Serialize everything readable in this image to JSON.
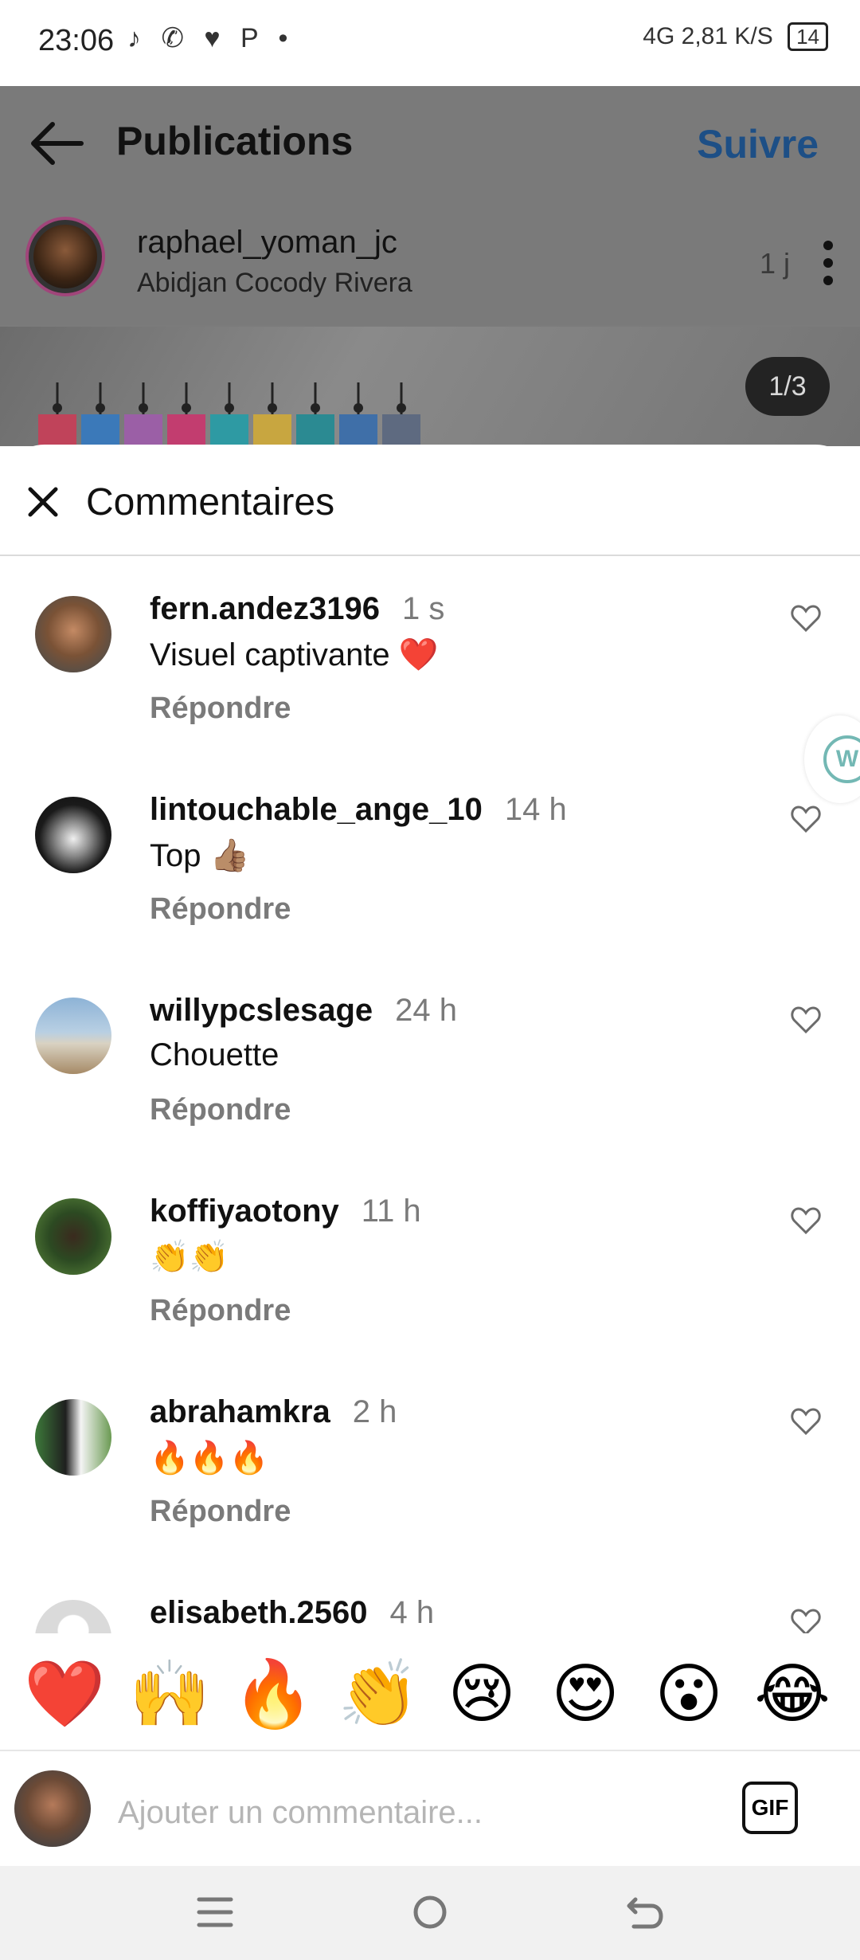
{
  "status_bar": {
    "time": "23:06",
    "left_icons": "♪ ✆ ♥ P •",
    "right_text": "4G  2,81 K/S",
    "battery": "14"
  },
  "post": {
    "page_title": "Publications",
    "follow_label": "Suivre",
    "username": "raphael_yoman_jc",
    "location": "Abidjan Cocody Rivera",
    "time": "1 j",
    "counter": "1/3"
  },
  "comments_sheet": {
    "title": "Commentaires",
    "reply_label": "Répondre",
    "comments": [
      {
        "user": "fern.andez3196",
        "time": "1 s",
        "text": "Visuel captivante ❤️"
      },
      {
        "user": "lintouchable_ange_10",
        "time": "14 h",
        "text": "Top 👍🏽"
      },
      {
        "user": "willypcslesage",
        "time": "24 h",
        "text": "Chouette"
      },
      {
        "user": "koffiyaotony",
        "time": "11 h",
        "text": "👏👏"
      },
      {
        "user": "abrahamkra",
        "time": "2 h",
        "text": "🔥🔥🔥"
      },
      {
        "user": "elisabeth.2560",
        "time": "4 h",
        "text": ""
      }
    ]
  },
  "emoji_bar": [
    "❤️",
    "🙌",
    "🔥",
    "👏",
    "😢",
    "😍",
    "😮",
    "😂"
  ],
  "composer": {
    "placeholder": "Ajouter un commentaire...",
    "gif_label": "GIF"
  },
  "floating_badge": "W",
  "colors": {
    "follow": "#1d4f86",
    "reply": "#7a7a7a",
    "placeholder": "#b5b5b5",
    "dim_overlay": "#7b7b7b"
  }
}
